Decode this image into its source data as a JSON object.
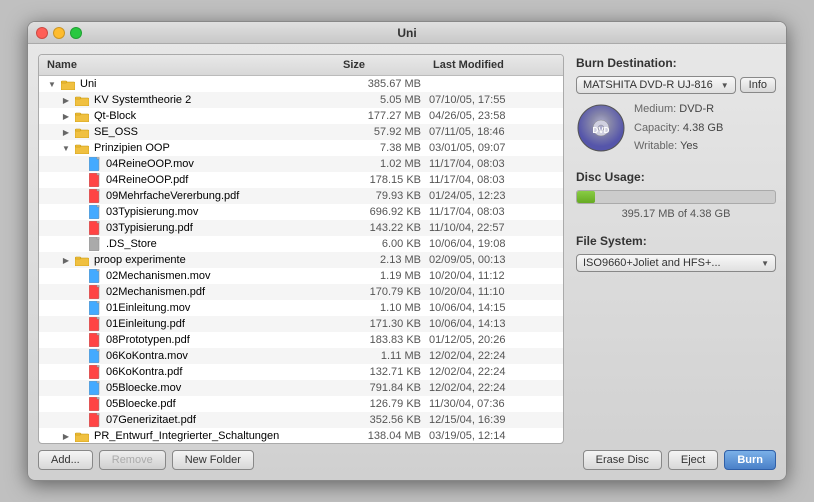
{
  "window": {
    "title": "Uni"
  },
  "file_list": {
    "columns": {
      "name": "Name",
      "size": "Size",
      "modified": "Last Modified"
    },
    "rows": [
      {
        "id": 1,
        "indent": 0,
        "type": "folder",
        "expanded": true,
        "name": "Uni",
        "size": "385.67 MB",
        "date": "",
        "selected": false,
        "alt": false
      },
      {
        "id": 2,
        "indent": 1,
        "type": "folder",
        "expanded": false,
        "name": "KV Systemtheorie 2",
        "size": "5.05 MB",
        "date": "07/10/05, 17:55",
        "selected": false,
        "alt": true
      },
      {
        "id": 3,
        "indent": 1,
        "type": "folder",
        "expanded": false,
        "name": "Qt-Block",
        "size": "177.27 MB",
        "date": "04/26/05, 23:58",
        "selected": false,
        "alt": false
      },
      {
        "id": 4,
        "indent": 1,
        "type": "folder",
        "expanded": false,
        "name": "SE_OSS",
        "size": "57.92 MB",
        "date": "07/11/05, 18:46",
        "selected": false,
        "alt": true
      },
      {
        "id": 5,
        "indent": 1,
        "type": "folder",
        "expanded": true,
        "name": "Prinzipien OOP",
        "size": "7.38 MB",
        "date": "03/01/05, 09:07",
        "selected": false,
        "alt": false
      },
      {
        "id": 6,
        "indent": 2,
        "type": "file-mov",
        "expanded": false,
        "name": "04ReineOOP.mov",
        "size": "1.02 MB",
        "date": "11/17/04, 08:03",
        "selected": false,
        "alt": true
      },
      {
        "id": 7,
        "indent": 2,
        "type": "file-pdf",
        "expanded": false,
        "name": "04ReineOOP.pdf",
        "size": "178.15 KB",
        "date": "11/17/04, 08:03",
        "selected": false,
        "alt": false
      },
      {
        "id": 8,
        "indent": 2,
        "type": "file-pdf",
        "expanded": false,
        "name": "09MehrfacheVererbung.pdf",
        "size": "79.93 KB",
        "date": "01/24/05, 12:23",
        "selected": false,
        "alt": true
      },
      {
        "id": 9,
        "indent": 2,
        "type": "file-mov",
        "expanded": false,
        "name": "03Typisierung.mov",
        "size": "696.92 KB",
        "date": "11/17/04, 08:03",
        "selected": false,
        "alt": false
      },
      {
        "id": 10,
        "indent": 2,
        "type": "file-pdf",
        "expanded": false,
        "name": "03Typisierung.pdf",
        "size": "143.22 KB",
        "date": "11/10/04, 22:57",
        "selected": false,
        "alt": true
      },
      {
        "id": 11,
        "indent": 2,
        "type": "file-generic",
        "expanded": false,
        "name": ".DS_Store",
        "size": "6.00 KB",
        "date": "10/06/04, 19:08",
        "selected": false,
        "alt": false
      },
      {
        "id": 12,
        "indent": 1,
        "type": "folder",
        "expanded": false,
        "name": "proop experimente",
        "size": "2.13 MB",
        "date": "02/09/05, 00:13",
        "selected": false,
        "alt": true
      },
      {
        "id": 13,
        "indent": 2,
        "type": "file-mov",
        "expanded": false,
        "name": "02Mechanismen.mov",
        "size": "1.19 MB",
        "date": "10/20/04, 11:12",
        "selected": false,
        "alt": false
      },
      {
        "id": 14,
        "indent": 2,
        "type": "file-pdf",
        "expanded": false,
        "name": "02Mechanismen.pdf",
        "size": "170.79 KB",
        "date": "10/20/04, 11:10",
        "selected": false,
        "alt": true
      },
      {
        "id": 15,
        "indent": 2,
        "type": "file-mov",
        "expanded": false,
        "name": "01Einleitung.mov",
        "size": "1.10 MB",
        "date": "10/06/04, 14:15",
        "selected": false,
        "alt": false
      },
      {
        "id": 16,
        "indent": 2,
        "type": "file-pdf",
        "expanded": false,
        "name": "01Einleitung.pdf",
        "size": "171.30 KB",
        "date": "10/06/04, 14:13",
        "selected": false,
        "alt": true
      },
      {
        "id": 17,
        "indent": 2,
        "type": "file-pdf",
        "expanded": false,
        "name": "08Prototypen.pdf",
        "size": "183.83 KB",
        "date": "01/12/05, 20:26",
        "selected": false,
        "alt": false
      },
      {
        "id": 18,
        "indent": 2,
        "type": "file-mov",
        "expanded": false,
        "name": "06KoKontra.mov",
        "size": "1.11 MB",
        "date": "12/02/04, 22:24",
        "selected": false,
        "alt": true
      },
      {
        "id": 19,
        "indent": 2,
        "type": "file-pdf",
        "expanded": false,
        "name": "06KoKontra.pdf",
        "size": "132.71 KB",
        "date": "12/02/04, 22:24",
        "selected": false,
        "alt": false
      },
      {
        "id": 20,
        "indent": 2,
        "type": "file-mov",
        "expanded": false,
        "name": "05Bloecke.mov",
        "size": "791.84 KB",
        "date": "12/02/04, 22:24",
        "selected": false,
        "alt": true
      },
      {
        "id": 21,
        "indent": 2,
        "type": "file-pdf",
        "expanded": false,
        "name": "05Bloecke.pdf",
        "size": "126.79 KB",
        "date": "11/30/04, 07:36",
        "selected": false,
        "alt": false
      },
      {
        "id": 22,
        "indent": 2,
        "type": "file-pdf",
        "expanded": false,
        "name": "07Generizitaet.pdf",
        "size": "352.56 KB",
        "date": "12/15/04, 16:39",
        "selected": false,
        "alt": true
      },
      {
        "id": 23,
        "indent": 1,
        "type": "folder",
        "expanded": false,
        "name": "PR_Entwurf_Integrierter_Schaltungen",
        "size": "138.04 MB",
        "date": "03/19/05, 12:14",
        "selected": false,
        "alt": false
      }
    ]
  },
  "bottom_buttons": {
    "add": "Add...",
    "remove": "Remove",
    "new_folder": "New Folder"
  },
  "right_panel": {
    "burn_destination": {
      "label": "Burn Destination:",
      "drive": "MATSHITA DVD-R UJ-816",
      "info_btn": "Info",
      "medium": "DVD-R",
      "capacity": "4.38 GB",
      "writable": "Yes"
    },
    "disc_usage": {
      "label": "Disc Usage:",
      "used": "395.17 MB of 4.38 GB",
      "percent": 9
    },
    "file_system": {
      "label": "File System:",
      "value": "ISO9660+Joliet and HFS+..."
    },
    "action_buttons": {
      "erase": "Erase Disc",
      "eject": "Eject",
      "burn": "Burn"
    }
  }
}
